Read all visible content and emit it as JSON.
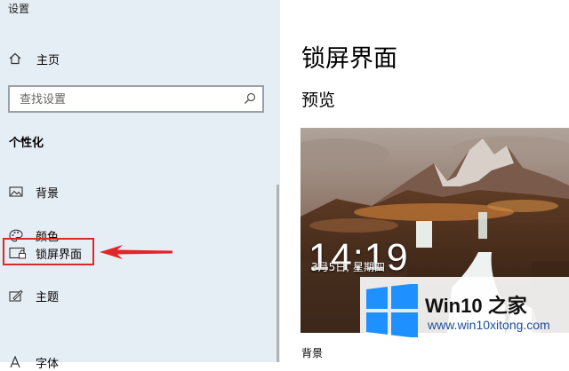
{
  "app": {
    "title": "设置"
  },
  "sidebar": {
    "home_label": "主页",
    "search_placeholder": "查找设置",
    "section_title": "个性化",
    "items": [
      {
        "label": "背景",
        "icon": "picture-icon"
      },
      {
        "label": "颜色",
        "icon": "palette-icon"
      },
      {
        "label": "锁屏界面",
        "icon": "lock-screen-icon",
        "selected": true
      },
      {
        "label": "主题",
        "icon": "theme-icon"
      },
      {
        "label": "字体",
        "icon": "font-icon"
      }
    ]
  },
  "main": {
    "title": "锁屏界面",
    "preview_label": "预览",
    "preview_time": "14:19",
    "preview_date": "3月5日, 星期四",
    "background_label": "背景"
  },
  "watermark": {
    "brand": "Win10 之家",
    "url": "www.win10xitong.com"
  },
  "colors": {
    "sidebar_bg": "#e6eef5",
    "highlight": "#e0262a",
    "win_blue": "#1e90ff"
  }
}
